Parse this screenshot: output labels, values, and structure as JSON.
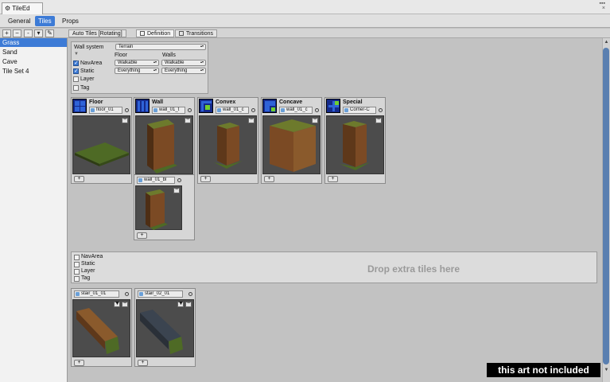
{
  "window": {
    "title": "TileEd",
    "controls": "▪▪▪\n×"
  },
  "top_tabs": [
    {
      "label": "General",
      "selected": false
    },
    {
      "label": "Tiles",
      "selected": true
    },
    {
      "label": "Props",
      "selected": false
    }
  ],
  "toolbar": {
    "buttons": [
      {
        "glyph": "+",
        "icon": "add-icon"
      },
      {
        "glyph": "−",
        "icon": "remove-icon"
      },
      {
        "glyph": "-",
        "icon": "separator-icon"
      },
      {
        "glyph": "▾",
        "icon": "chevron-down-icon"
      },
      {
        "glyph": "✎",
        "icon": "pencil-icon"
      }
    ],
    "strip_tabs": [
      {
        "label": "Auto Tiles [Rotating]"
      },
      {
        "label": "Definition"
      },
      {
        "label": "Transitions"
      }
    ]
  },
  "sidebar": {
    "items": [
      {
        "label": "Grass",
        "selected": true
      },
      {
        "label": "Sand"
      },
      {
        "label": "Cave"
      },
      {
        "label": "Tile Set 4"
      }
    ]
  },
  "definition": {
    "wall_system_label": "Wall system",
    "wall_system_value": "Terrain",
    "collapse_glyph": "▼",
    "floor_header": "Floor",
    "walls_header": "Walls",
    "options": [
      {
        "label": "NavArea",
        "checked": true
      },
      {
        "label": "Static",
        "checked": true
      },
      {
        "label": "Layer",
        "checked": false
      },
      {
        "label": "Tag",
        "checked": false
      }
    ],
    "navarea_floor": "Walkable",
    "navarea_walls": "Walkable",
    "static_floor": "Everything",
    "static_walls": "Everything"
  },
  "tile_cards": [
    {
      "title": "Floor",
      "asset": "floor_01"
    },
    {
      "title": "Wall",
      "asset": "wall_01_t"
    },
    {
      "title": "Convex",
      "asset": "wall_01_c"
    },
    {
      "title": "Concave",
      "asset": "wall_01_c"
    },
    {
      "title": "Special",
      "asset": "Corner-C"
    }
  ],
  "extra_wall": {
    "asset": "wall_01_bl"
  },
  "extra_options": [
    "NavArea",
    "Static",
    "Layer",
    "Tag"
  ],
  "drop_zone": {
    "text": "Drop extra tiles here"
  },
  "extra_tiles": [
    {
      "asset": "stair_01_01"
    },
    {
      "asset": "stair_02_01"
    }
  ],
  "glyphs": {
    "minus": "−",
    "plus": "+",
    "up": "▲",
    "down": "▼"
  },
  "notice": "this art not included",
  "colors": {
    "selection": "#3d7bd6",
    "grass": "#4e6a25",
    "wood": "#7b4a24",
    "preview_bg": "#4c4c4c",
    "stone": "#3b4450"
  }
}
